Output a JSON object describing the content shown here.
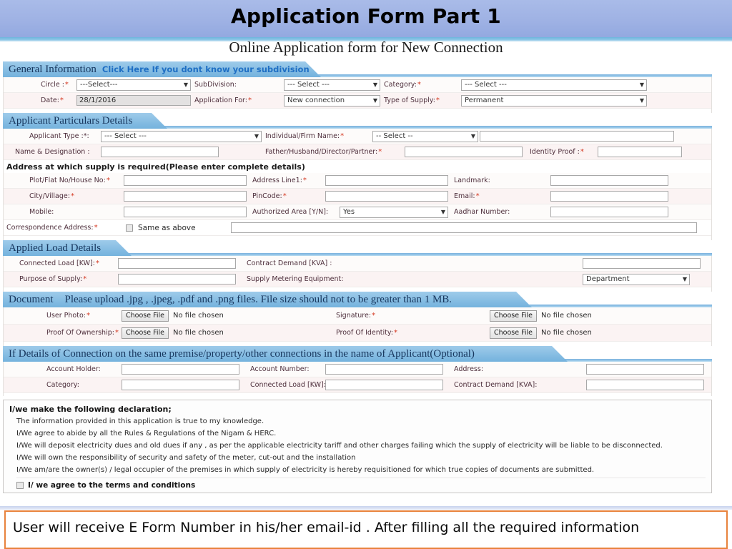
{
  "header": {
    "title": "Application Form Part 1",
    "subtitle": "Online Application form for New Connection"
  },
  "sections": {
    "general": {
      "title": "General Information",
      "hint": "Click Here If you dont know your subdivision",
      "circle_label": "Circle :",
      "circle_value": "---Select---",
      "subdivision_label": "SubDivision:",
      "subdivision_value": "--- Select ---",
      "category_label": "Category:",
      "category_value": "--- Select ---",
      "date_label": "Date:",
      "date_value": "28/1/2016",
      "application_for_label": "Application For:",
      "application_for_value": "New connection",
      "type_of_supply_label": "Type of Supply:",
      "type_of_supply_value": "Permanent"
    },
    "applicant": {
      "title": "Applicant Particulars Details",
      "applicant_type_label": "Applicant Type :*:",
      "applicant_type_value": "--- Select ---",
      "firm_name_label": "Individual/Firm Name:",
      "firm_name_value": "-- Select --",
      "firm_name_text": "",
      "name_designation_label": "Name & Designation :",
      "name_designation_value": "",
      "father_label": "Father/Husband/Director/Partner:",
      "father_value": "",
      "identity_proof_label": "Identity Proof :",
      "identity_proof_value": "",
      "address_heading": "Address at which supply is required(Please enter complete details)",
      "plot_label": "Plot/Flat No/House No:",
      "plot_value": "",
      "address_line1_label": "Address Line1:",
      "address_line1_value": "",
      "landmark_label": "Landmark:",
      "landmark_value": "",
      "city_label": "City/Village:",
      "city_value": "",
      "pincode_label": "PinCode:",
      "pincode_value": "",
      "email_label": "Email:",
      "email_value": "",
      "mobile_label": "Mobile:",
      "mobile_value": "",
      "authorized_area_label": "Authorized Area [Y/N]:",
      "authorized_area_value": "Yes",
      "aadhar_label": "Aadhar Number:",
      "aadhar_value": "",
      "correspondence_label": "Correspondence Address:",
      "same_as_above_label": "Same as above",
      "correspondence_value": ""
    },
    "load": {
      "title": "Applied Load Details",
      "connected_load_label": "Connected Load [KW]:",
      "connected_load_value": "",
      "contract_demand_label": "Contract Demand [KVA] :",
      "contract_demand_value": "",
      "purpose_label": "Purpose of Supply:",
      "purpose_value": "",
      "metering_label": "Supply Metering Equipment:",
      "metering_value": "Department"
    },
    "document": {
      "title": "Document",
      "note": "Please upload .jpg , .jpeg, .pdf and .png files. File size should not to be greater than 1 MB.",
      "choose_file_label": "Choose File",
      "no_file_label": "No file chosen",
      "user_photo_label": "User Photo:",
      "signature_label": "Signature:",
      "proof_ownership_label": "Proof Of Ownership:",
      "proof_identity_label": "Proof Of Identity:"
    },
    "existing": {
      "title": "If Details of Connection on the same premise/property/other connections in the name of Applicant(Optional)",
      "account_holder_label": "Account Holder:",
      "account_holder_value": "",
      "account_number_label": "Account Number:",
      "account_number_value": "",
      "address_label": "Address:",
      "address_value": "",
      "category_label": "Category:",
      "category_value": "",
      "connected_load_label": "Connected Load [KW]:",
      "connected_load_value": "",
      "contract_demand_label": "Contract Demand [KVA]:",
      "contract_demand_value": ""
    },
    "declaration": {
      "heading": "I/we make the following declaration;",
      "line1": "The information provided in this application is true to my knowledge.",
      "line2": "I/We agree to abide by all the Rules & Regulations of the Nigam & HERC.",
      "line3": "I/We will deposit electricity dues and old dues if any , as per the applicable electricity tariff and other charges failing which the supply of electricity will be liable to be disconnected.",
      "line4": "I/We will own the responsibility of security and safety of the meter, cut-out and the installation",
      "line5": "I/We am/are the owner(s) / legal occupier of the premises in which supply of electricity is hereby requisitioned for which true copies of documents are submitted.",
      "agree_label": "I/ we agree to the terms and conditions"
    }
  },
  "footer": {
    "note": "User will receive E Form Number in his/her email-id . After filling all the required information"
  },
  "icons": {
    "dropdown_arrow": "▼"
  },
  "colors": {
    "title_band": "#9fb2e4",
    "section_bar": "#7db4de",
    "hint_link": "#1f6fc4",
    "required_star": "#d4361f",
    "callout_border": "#e8823c"
  }
}
